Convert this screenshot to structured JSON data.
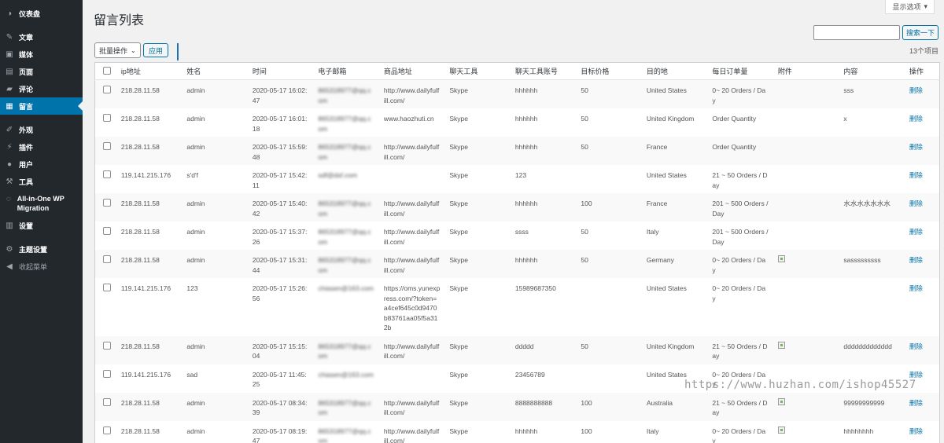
{
  "sidebar": {
    "items": [
      {
        "label": "仪表盘",
        "icon": "dashboard-icon"
      },
      {
        "label": "文章",
        "icon": "pin-icon"
      },
      {
        "label": "媒体",
        "icon": "media-icon"
      },
      {
        "label": "页面",
        "icon": "page-icon"
      },
      {
        "label": "评论",
        "icon": "comment-icon"
      },
      {
        "label": "留言",
        "icon": "message-icon",
        "active": true
      },
      {
        "label": "外观",
        "icon": "brush-icon"
      },
      {
        "label": "插件",
        "icon": "plugin-icon"
      },
      {
        "label": "用户",
        "icon": "user-icon"
      },
      {
        "label": "工具",
        "icon": "wrench-icon"
      },
      {
        "label": "All-in-One WP Migration",
        "icon": "migration-icon"
      },
      {
        "label": "设置",
        "icon": "settings-icon"
      },
      {
        "label": "主题设置",
        "icon": "gear-icon"
      },
      {
        "label": "收起菜单",
        "icon": "collapse-icon"
      }
    ]
  },
  "header": {
    "title": "留言列表",
    "screen_options": "显示选项",
    "search_button": "搜索一下",
    "search_value": "",
    "bulk_action": "批量操作",
    "apply": "应用",
    "item_count": "13个项目"
  },
  "table": {
    "columns": [
      "ip地址",
      "姓名",
      "时间",
      "电子邮箱",
      "商品地址",
      "聊天工具",
      "聊天工具账号",
      "目标价格",
      "目的地",
      "每日订单量",
      "附件",
      "内容",
      "操作"
    ],
    "rows": [
      {
        "ip": "218.28.11.58",
        "name": "admin",
        "time": "2020-05-17 16:02:47",
        "email": "865318977@qq.com",
        "url": "http://www.dailyfulfill.com/",
        "tool": "Skype",
        "account": "hhhhhh",
        "price": "50",
        "dest": "United States",
        "orders": "0~ 20 Orders / Day",
        "attach": false,
        "content": "sss",
        "action": "删除"
      },
      {
        "ip": "218.28.11.58",
        "name": "admin",
        "time": "2020-05-17 16:01:18",
        "email": "865318977@qq.com",
        "url": "www.haozhuti.cn",
        "tool": "Skype",
        "account": "hhhhhh",
        "price": "50",
        "dest": "United Kingdom",
        "orders": "Order Quantity",
        "attach": false,
        "content": "x",
        "action": "删除"
      },
      {
        "ip": "218.28.11.58",
        "name": "admin",
        "time": "2020-05-17 15:59:48",
        "email": "865318977@qq.com",
        "url": "http://www.dailyfulfill.com/",
        "tool": "Skype",
        "account": "hhhhhh",
        "price": "50",
        "dest": "France",
        "orders": "Order Quantity",
        "attach": false,
        "content": "",
        "action": "删除"
      },
      {
        "ip": "119.141.215.176",
        "name": "s'd'f",
        "time": "2020-05-17 15:42:11",
        "email": "sdf@dsf.com",
        "url": "",
        "tool": "Skype",
        "account": "123",
        "price": "",
        "dest": "United States",
        "orders": "21 ~ 50 Orders / Day",
        "attach": false,
        "content": "",
        "action": "删除"
      },
      {
        "ip": "218.28.11.58",
        "name": "admin",
        "time": "2020-05-17 15:40:42",
        "email": "865318977@qq.com",
        "url": "http://www.dailyfulfill.com/",
        "tool": "Skype",
        "account": "hhhhhh",
        "price": "100",
        "dest": "France",
        "orders": "201 ~ 500 Orders / Day",
        "attach": false,
        "content": "水水水水水水水",
        "action": "删除"
      },
      {
        "ip": "218.28.11.58",
        "name": "admin",
        "time": "2020-05-17 15:37:26",
        "email": "865318977@qq.com",
        "url": "http://www.dailyfulfill.com/",
        "tool": "Skype",
        "account": "ssss",
        "price": "50",
        "dest": "Italy",
        "orders": "201 ~ 500 Orders / Day",
        "attach": false,
        "content": "",
        "action": "删除"
      },
      {
        "ip": "218.28.11.58",
        "name": "admin",
        "time": "2020-05-17 15:31:44",
        "email": "865318977@qq.com",
        "url": "http://www.dailyfulfill.com/",
        "tool": "Skype",
        "account": "hhhhhh",
        "price": "50",
        "dest": "Germany",
        "orders": "0~ 20 Orders / Day",
        "attach": true,
        "content": "sasssssssss",
        "action": "删除"
      },
      {
        "ip": "119.141.215.176",
        "name": "123",
        "time": "2020-05-17 15:26:56",
        "email": "chiasen@163.com",
        "url": "https://oms.yunexpress.com/?token=a4cef645c0d9470b83761aa05f5a312b",
        "tool": "Skype",
        "account": "15989687350",
        "price": "",
        "dest": "United States",
        "orders": "0~ 20 Orders / Day",
        "attach": false,
        "content": "",
        "action": "删除"
      },
      {
        "ip": "218.28.11.58",
        "name": "admin",
        "time": "2020-05-17 15:15:04",
        "email": "865318977@qq.com",
        "url": "http://www.dailyfulfill.com/",
        "tool": "Skype",
        "account": "ddddd",
        "price": "50",
        "dest": "United Kingdom",
        "orders": "21 ~ 50 Orders / Day",
        "attach": true,
        "content": "ddddddddddddd",
        "action": "删除"
      },
      {
        "ip": "119.141.215.176",
        "name": "sad",
        "time": "2020-05-17 11:45:25",
        "email": "chiasen@163.com",
        "url": "",
        "tool": "Skype",
        "account": "23456789",
        "price": "",
        "dest": "United States",
        "orders": "0~ 20 Orders / Day",
        "attach": false,
        "content": "",
        "action": "删除"
      },
      {
        "ip": "218.28.11.58",
        "name": "admin",
        "time": "2020-05-17 08:34:39",
        "email": "865318977@qq.com",
        "url": "http://www.dailyfulfill.com/",
        "tool": "Skype",
        "account": "8888888888",
        "price": "100",
        "dest": "Australia",
        "orders": "21 ~ 50 Orders / Day",
        "attach": true,
        "content": "99999999999",
        "action": "删除"
      },
      {
        "ip": "218.28.11.58",
        "name": "admin",
        "time": "2020-05-17 08:19:47",
        "email": "865318977@qq.com",
        "url": "http://www.dailyfulfill.com/",
        "tool": "Skype",
        "account": "hhhhhh",
        "price": "100",
        "dest": "Italy",
        "orders": "0~ 20 Orders / Day",
        "attach": true,
        "content": "hhhhhhhh",
        "action": "删除"
      }
    ]
  },
  "watermark": "https://www.huzhan.com/ishop45527",
  "colors": {
    "sidebar_bg": "#23282d",
    "active": "#0073aa",
    "link": "#0073aa"
  }
}
